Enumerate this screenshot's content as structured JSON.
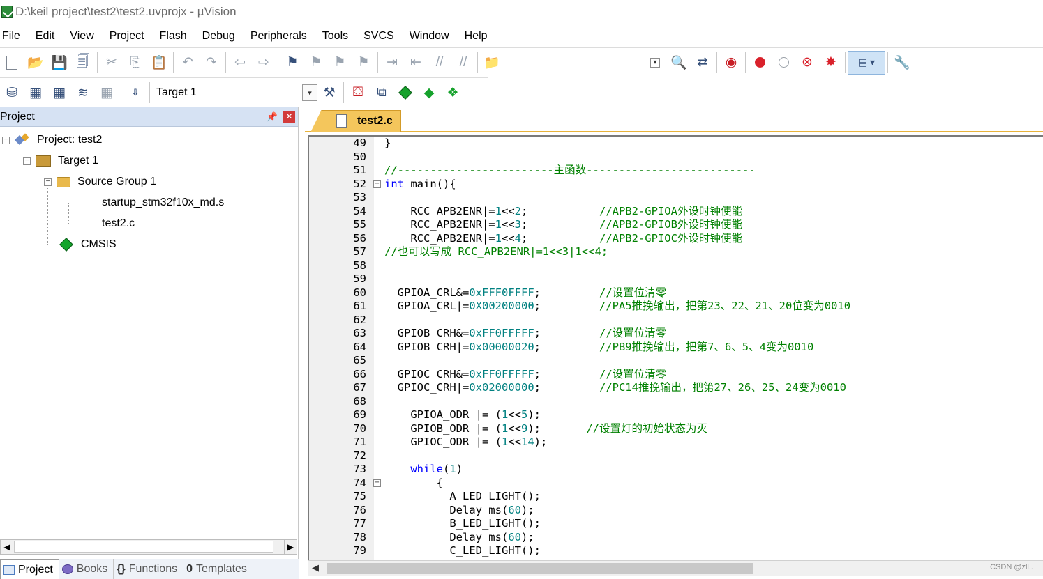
{
  "window": {
    "title": "D:\\keil project\\test2\\test2.uvprojx - µVision"
  },
  "menu": [
    "File",
    "Edit",
    "View",
    "Project",
    "Flash",
    "Debug",
    "Peripherals",
    "Tools",
    "SVCS",
    "Window",
    "Help"
  ],
  "toolbar2": {
    "target": "Target 1"
  },
  "project_panel": {
    "title": "Project",
    "tree": {
      "project": "Project: test2",
      "target": "Target 1",
      "group": "Source Group 1",
      "files": [
        "startup_stm32f10x_md.s",
        "test2.c"
      ],
      "cmsis": "CMSIS"
    },
    "tabs": [
      "Project",
      "Books",
      "Functions",
      "Templates"
    ]
  },
  "editor": {
    "tab": "test2.c",
    "lines": [
      {
        "n": "49",
        "t": "}"
      },
      {
        "n": "50",
        "t": ""
      },
      {
        "n": "51",
        "t": "//------------------------主函数--------------------------"
      },
      {
        "n": "52",
        "t": "int main(){"
      },
      {
        "n": "53",
        "t": ""
      },
      {
        "n": "54",
        "t": "    RCC_APB2ENR|=1<<2;           //APB2-GPIOA外设时钟使能"
      },
      {
        "n": "55",
        "t": "    RCC_APB2ENR|=1<<3;           //APB2-GPIOB外设时钟使能"
      },
      {
        "n": "56",
        "t": "    RCC_APB2ENR|=1<<4;           //APB2-GPIOC外设时钟使能"
      },
      {
        "n": "57",
        "t": "//也可以写成 RCC_APB2ENR|=1<<3|1<<4;"
      },
      {
        "n": "58",
        "t": ""
      },
      {
        "n": "59",
        "t": ""
      },
      {
        "n": "60",
        "t": "  GPIOA_CRL&=0xFFF0FFFF;         //设置位清零"
      },
      {
        "n": "61",
        "t": "  GPIOA_CRL|=0X00200000;         //PA5推挽输出，把第23、22、21、20位变为0010"
      },
      {
        "n": "62",
        "t": ""
      },
      {
        "n": "63",
        "t": "  GPIOB_CRH&=0xFF0FFFFF;         //设置位清零"
      },
      {
        "n": "64",
        "t": "  GPIOB_CRH|=0x00000020;         //PB9推挽输出，把第7、6、5、4变为0010"
      },
      {
        "n": "65",
        "t": ""
      },
      {
        "n": "66",
        "t": "  GPIOC_CRH&=0xFF0FFFFF;         //设置位清零"
      },
      {
        "n": "67",
        "t": "  GPIOC_CRH|=0x02000000;         //PC14推挽输出，把第27、26、25、24变为0010"
      },
      {
        "n": "68",
        "t": ""
      },
      {
        "n": "69",
        "t": "    GPIOA_ODR |= (1<<5);"
      },
      {
        "n": "70",
        "t": "    GPIOB_ODR |= (1<<9);       //设置灯的初始状态为灭"
      },
      {
        "n": "71",
        "t": "    GPIOC_ODR |= (1<<14);"
      },
      {
        "n": "72",
        "t": ""
      },
      {
        "n": "73",
        "t": "    while(1)"
      },
      {
        "n": "74",
        "t": "        {"
      },
      {
        "n": "75",
        "t": "          A_LED_LIGHT();"
      },
      {
        "n": "76",
        "t": "          Delay_ms(60);"
      },
      {
        "n": "77",
        "t": "          B_LED_LIGHT();"
      },
      {
        "n": "78",
        "t": "          Delay_ms(60);"
      },
      {
        "n": "79",
        "t": "          C_LED_LIGHT();"
      }
    ]
  },
  "watermark": "CSDN @zll.."
}
